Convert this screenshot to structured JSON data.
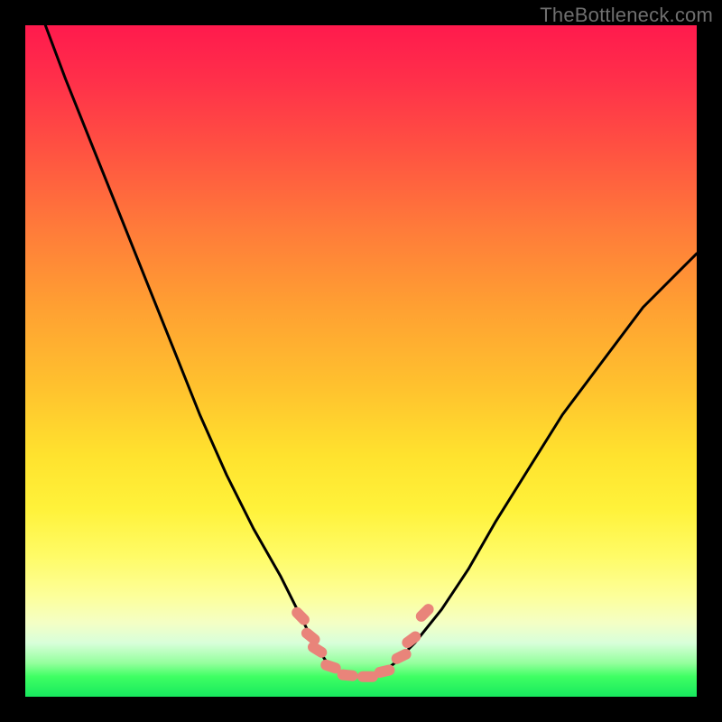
{
  "watermark": {
    "text": "TheBottleneck.com"
  },
  "colors": {
    "background": "#000000",
    "watermark": "#6f6f6f",
    "curve": "#000000",
    "coral_marker": "#e9847a",
    "gradient_stops": [
      "#ff1a4d",
      "#ff2f4a",
      "#ff5042",
      "#ff7a3a",
      "#ffa032",
      "#ffc22e",
      "#ffe22e",
      "#fff23a",
      "#fffb66",
      "#fdff9a",
      "#f4ffc5",
      "#d8ffda",
      "#94ff9d",
      "#3fff63",
      "#17e85e"
    ]
  },
  "chart_data": {
    "type": "line",
    "title": "",
    "xlabel": "",
    "ylabel": "",
    "xlim": [
      0,
      100
    ],
    "ylim": [
      0,
      100
    ],
    "note": "No axes/ticks in source image; values are relative percentages of the plot area. y=0 at bottom (green), y=100 at top (red).",
    "series": [
      {
        "name": "left-arm",
        "x": [
          3,
          6,
          10,
          14,
          18,
          22,
          26,
          30,
          34,
          38,
          41,
          43,
          45
        ],
        "y": [
          100,
          92,
          82,
          72,
          62,
          52,
          42,
          33,
          25,
          18,
          12,
          8,
          5
        ]
      },
      {
        "name": "valley-floor",
        "x": [
          45,
          47,
          49,
          51,
          53,
          55
        ],
        "y": [
          5,
          3.5,
          3,
          3,
          3.5,
          5
        ]
      },
      {
        "name": "right-arm",
        "x": [
          55,
          58,
          62,
          66,
          70,
          75,
          80,
          86,
          92,
          98,
          100
        ],
        "y": [
          5,
          8,
          13,
          19,
          26,
          34,
          42,
          50,
          58,
          64,
          66
        ]
      }
    ],
    "markers": {
      "name": "coral-dashes-near-valley",
      "note": "approximate positions of the short coral rounded dash segments",
      "points": [
        {
          "x": 41.0,
          "y": 12.0
        },
        {
          "x": 42.5,
          "y": 9.0
        },
        {
          "x": 43.5,
          "y": 7.0
        },
        {
          "x": 45.5,
          "y": 4.5
        },
        {
          "x": 48.0,
          "y": 3.2
        },
        {
          "x": 51.0,
          "y": 3.0
        },
        {
          "x": 53.5,
          "y": 3.8
        },
        {
          "x": 56.0,
          "y": 6.0
        },
        {
          "x": 57.5,
          "y": 8.5
        },
        {
          "x": 59.5,
          "y": 12.5
        }
      ]
    }
  }
}
